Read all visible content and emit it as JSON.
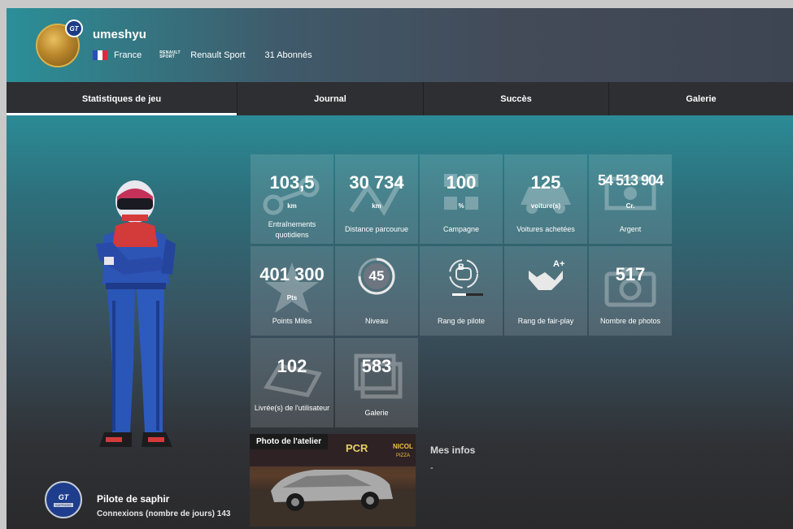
{
  "profile": {
    "username": "umeshyu",
    "country": "France",
    "manufacturer_logo": "RENAULT SPORT",
    "manufacturer": "Renault Sport",
    "followers": "31 Abonnés",
    "avatar_badge": "GT"
  },
  "tabs": [
    {
      "label": "Statistiques de jeu",
      "active": true
    },
    {
      "label": "Journal",
      "active": false
    },
    {
      "label": "Succès",
      "active": false
    },
    {
      "label": "Galerie",
      "active": false
    }
  ],
  "stats": [
    {
      "value": "103,5",
      "unit": "km",
      "label": "Entraînements quotidiens",
      "icon": "training-icon"
    },
    {
      "value": "30 734",
      "unit": "km",
      "label": "Distance parcourue",
      "icon": "distance-icon"
    },
    {
      "value": "100",
      "unit": "%",
      "label": "Campagne",
      "icon": "campaign-icon"
    },
    {
      "value": "125",
      "unit": "voiture(s)",
      "label": "Voitures achetées",
      "icon": "cars-icon"
    },
    {
      "value": "54 513 904",
      "unit": "Cr.",
      "label": "Argent",
      "icon": "money-icon"
    },
    {
      "value": "401 300",
      "unit": "Pts",
      "label": "Points Miles",
      "icon": "miles-icon"
    },
    {
      "value": "45",
      "unit": "",
      "label": "Niveau",
      "icon": "level-icon"
    },
    {
      "value": "B",
      "unit": "",
      "label": "Rang de pilote",
      "icon": "driver-rank-icon"
    },
    {
      "value": "A+",
      "unit": "",
      "label": "Rang de fair-play",
      "icon": "fair-play-icon"
    },
    {
      "value": "517",
      "unit": "",
      "label": "Nombre de photos",
      "icon": "camera-icon"
    },
    {
      "value": "102",
      "unit": "",
      "label": "Livrée(s) de l'utilisateur",
      "icon": "livery-icon"
    },
    {
      "value": "583",
      "unit": "",
      "label": "Galerie",
      "icon": "gallery-icon"
    }
  ],
  "rank": {
    "badge_text": "GT",
    "badge_caption": "SAPPHIRE",
    "title": "Pilote de saphir",
    "logins": "Connexions (nombre de jours) 143"
  },
  "workshop": {
    "label": "Photo de l'atelier",
    "signs": [
      "PCR",
      "NICOL",
      "PIZZA"
    ]
  },
  "info": {
    "title": "Mes infos",
    "text": "-"
  },
  "colors": {
    "header_start": "#2b8f98",
    "header_end": "#3e4552",
    "tab_bar": "#2e2f33",
    "badge_blue": "#1e3d8c"
  }
}
